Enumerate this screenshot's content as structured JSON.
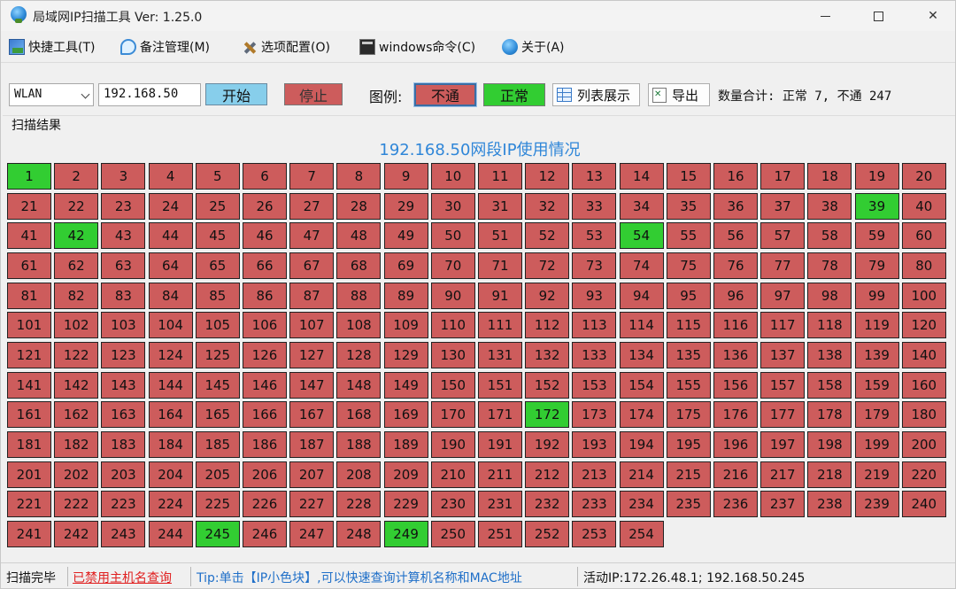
{
  "window": {
    "title": "局域网IP扫描工具 Ver: 1.25.0"
  },
  "menu": {
    "items": [
      {
        "label": "快捷工具(T)",
        "icon": "tools-icon"
      },
      {
        "label": "备注管理(M)",
        "icon": "note-icon"
      },
      {
        "label": "选项配置(O)",
        "icon": "config-icon"
      },
      {
        "label": "windows命令(C)",
        "icon": "cmd-icon"
      },
      {
        "label": "关于(A)",
        "icon": "globe-icon"
      }
    ]
  },
  "toolbar": {
    "adapter": "WLAN",
    "ip_prefix": "192.168.50",
    "start_label": "开始",
    "stop_label": "停止",
    "legend_label": "图例:",
    "legend_down": "不通",
    "legend_up": "正常",
    "list_label": "列表展示",
    "export_label": "导出",
    "count_text": "数量合计: 正常 7, 不通 247"
  },
  "results": {
    "group_label": "扫描结果",
    "title": "192.168.50网段IP使用情况",
    "range_start": 1,
    "range_end": 254,
    "online": [
      1,
      39,
      42,
      54,
      172,
      245,
      249
    ],
    "colors": {
      "down": "#cd5c5c",
      "up": "#32cd32"
    }
  },
  "status": {
    "state": "扫描完毕",
    "hostname_disabled": "已禁用主机名查询",
    "tip": "Tip:单击【IP小色块】,可以快速查询计算机名称和MAC地址",
    "active_ip": "活动IP:172.26.48.1; 192.168.50.245"
  }
}
